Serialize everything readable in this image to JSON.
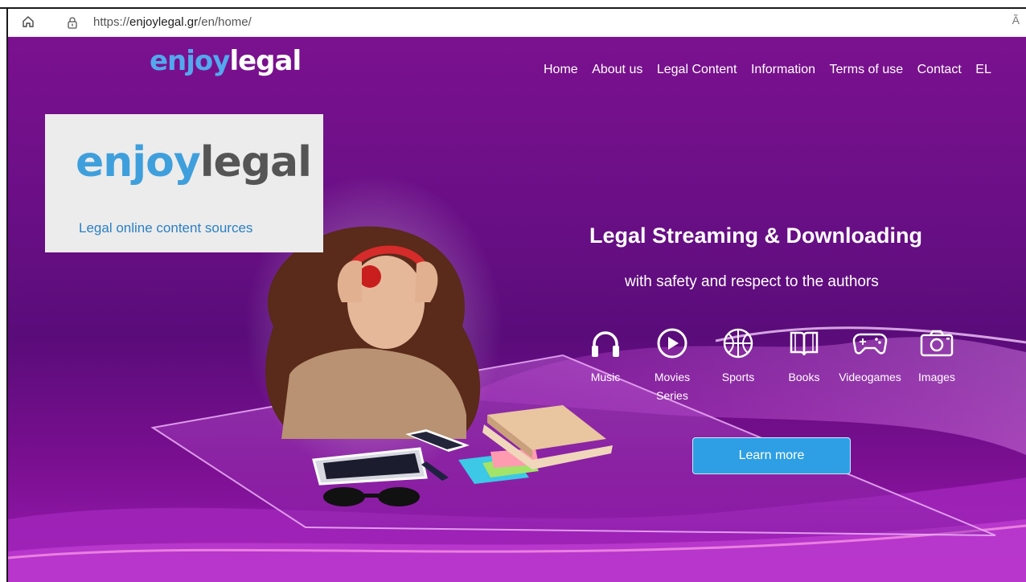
{
  "browser": {
    "url_prefix": "https://",
    "url_host": "enjoylegal.gr",
    "url_path": "/en/home/",
    "read_aloud": "Ã"
  },
  "header": {
    "logo_enjoy": "enjoy",
    "logo_legal": "legal",
    "nav": [
      "Home",
      "About us",
      "Legal Content",
      "Information",
      "Terms of use",
      "Contact",
      "EL"
    ]
  },
  "card": {
    "logo_enjoy": "enjoy",
    "logo_legal": "legal",
    "subtitle": "Legal online content sources"
  },
  "hero": {
    "headline": "Legal Streaming & Downloading",
    "subline": "with safety and respect to the authors",
    "categories": [
      {
        "label": "Music",
        "icon": "headphones-icon"
      },
      {
        "label": "Movies",
        "label2": "Series",
        "icon": "play-icon"
      },
      {
        "label": "Sports",
        "icon": "basketball-icon"
      },
      {
        "label": "Books",
        "icon": "book-icon"
      },
      {
        "label": "Videogames",
        "icon": "gamepad-icon"
      },
      {
        "label": "Images",
        "icon": "camera-icon"
      }
    ],
    "cta": "Learn more"
  },
  "colors": {
    "accent_blue": "#2e9fe4",
    "logo_blue": "#53a8ee",
    "hero_purple": "#6a0f86"
  }
}
